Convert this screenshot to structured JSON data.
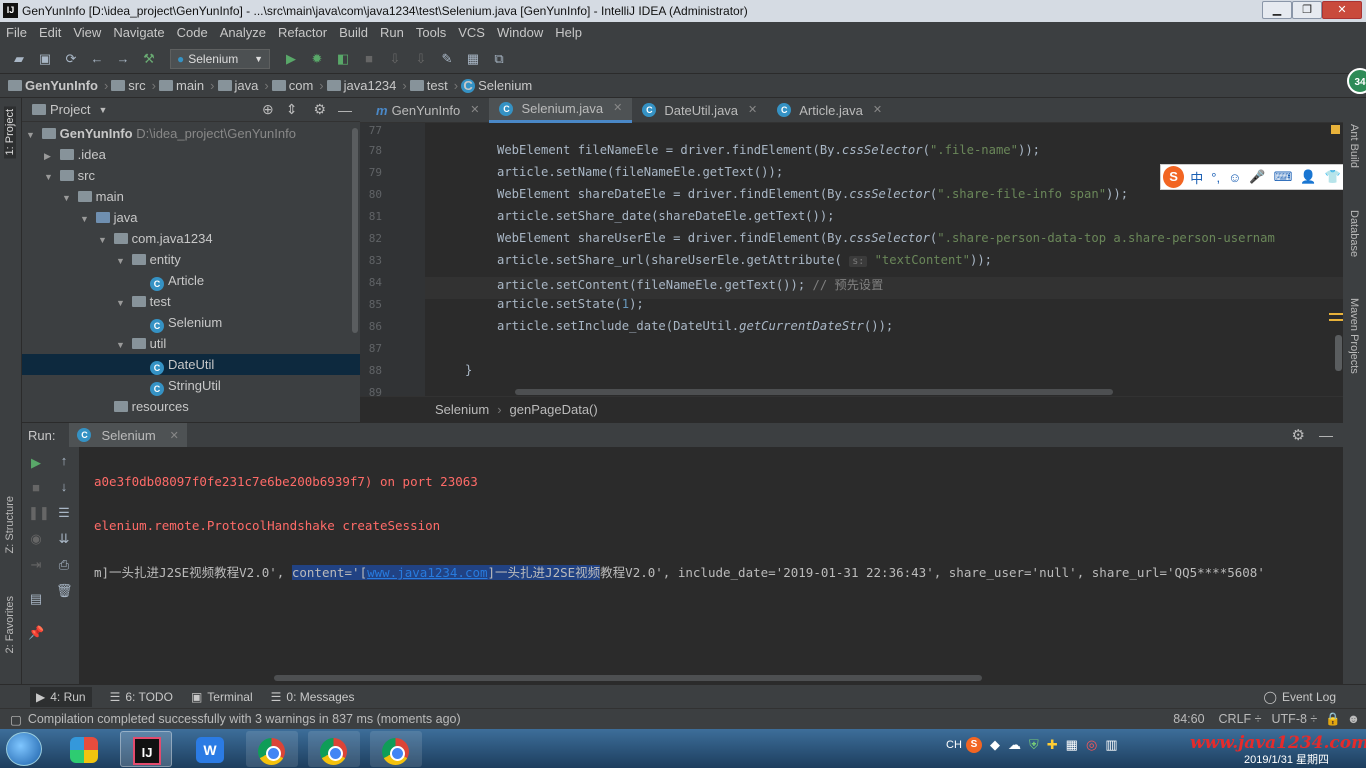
{
  "titlebar": {
    "title": "GenYunInfo [D:\\idea_project\\GenYunInfo] - ...\\src\\main\\java\\com\\java1234\\test\\Selenium.java [GenYunInfo] - IntelliJ IDEA (Administrator)",
    "logo": "IJ",
    "minimize": "▁",
    "restore": "❐",
    "close": "✕"
  },
  "menu": [
    "File",
    "Edit",
    "View",
    "Navigate",
    "Code",
    "Analyze",
    "Refactor",
    "Build",
    "Run",
    "Tools",
    "VCS",
    "Window",
    "Help"
  ],
  "toolbar": {
    "run_config": "Selenium"
  },
  "breadcrumb": [
    "GenYunInfo",
    "src",
    "main",
    "java",
    "com",
    "java1234",
    "test",
    "Selenium"
  ],
  "project": {
    "title": "Project",
    "tree": [
      {
        "label": "GenYunInfo",
        "extra": "D:\\idea_project\\GenYunInfo",
        "type": "folder",
        "arrow": "▼"
      },
      {
        "label": ".idea",
        "type": "folder",
        "arrow": "▶"
      },
      {
        "label": "src",
        "type": "folder",
        "arrow": "▼"
      },
      {
        "label": "main",
        "type": "folder",
        "arrow": "▼"
      },
      {
        "label": "java",
        "type": "folder",
        "arrow": "▼"
      },
      {
        "label": "com.java1234",
        "type": "folder",
        "arrow": "▼"
      },
      {
        "label": "entity",
        "type": "folder",
        "arrow": "▼"
      },
      {
        "label": "Article",
        "type": "class",
        "arrow": ""
      },
      {
        "label": "test",
        "type": "folder",
        "arrow": "▼"
      },
      {
        "label": "Selenium",
        "type": "class",
        "arrow": ""
      },
      {
        "label": "util",
        "type": "folder",
        "arrow": "▼"
      },
      {
        "label": "DateUtil",
        "type": "class",
        "arrow": ""
      },
      {
        "label": "StringUtil",
        "type": "class",
        "arrow": ""
      },
      {
        "label": "resources",
        "type": "folder",
        "arrow": ""
      }
    ]
  },
  "tabs": [
    {
      "label": "GenYunInfo",
      "icon": "m"
    },
    {
      "label": "Selenium.java",
      "icon": "C"
    },
    {
      "label": "DateUtil.java",
      "icon": "C"
    },
    {
      "label": "Article.java",
      "icon": "C"
    }
  ],
  "editor": {
    "line_numbers": [
      "77",
      "78",
      "79",
      "80",
      "81",
      "82",
      "83",
      "84",
      "85",
      "86",
      "87",
      "88",
      "89"
    ],
    "breadcrumb": [
      "Selenium",
      "genPageData()"
    ]
  },
  "run": {
    "label": "Run:",
    "config": "Selenium",
    "lines": {
      "l1": "a0e3f0db08097f0fe231c7e6be200b6939f7) on port 23063",
      "l2": "elenium.remote.ProtocolHandshake createSession",
      "l3a": "m]一头扎进J2SE视频教程V2.0', ",
      "l3b": "content='[",
      "l3c": "www.java1234.com",
      "l3d": "]一头扎进J2SE视频",
      "l3e": "教程V2.0', include_date='2019-01-31 22:36:43', share_user='null', share_url='QQ5****5608'"
    }
  },
  "left_strip": {
    "project": "1: Project",
    "structure": "Z: Structure",
    "favorites": "2: Favorites"
  },
  "right_strip": {
    "ant": "Ant Build",
    "database": "Database",
    "maven": "Maven Projects",
    "badge": "34"
  },
  "toolwindows": [
    {
      "label": "4: Run",
      "icon": "▶"
    },
    {
      "label": "6: TODO",
      "icon": "☰"
    },
    {
      "label": "Terminal",
      "icon": "▣"
    },
    {
      "label": "0: Messages",
      "icon": "☰"
    }
  ],
  "event_log": "Event Log",
  "status": {
    "message": "Compilation completed successfully with 3 warnings in 837 ms (moments ago)",
    "position": "84:60",
    "line_sep": "CRLF ÷",
    "encoding": "UTF-8 ÷"
  },
  "ime": {
    "chars": [
      "中",
      "°,",
      "☺",
      "🎤",
      "⌨",
      "👤",
      "👕",
      "▦"
    ]
  },
  "taskbar": {
    "watermark": "www.java1234.com",
    "date": "2019/1/31 星期四",
    "lang": "CH"
  }
}
